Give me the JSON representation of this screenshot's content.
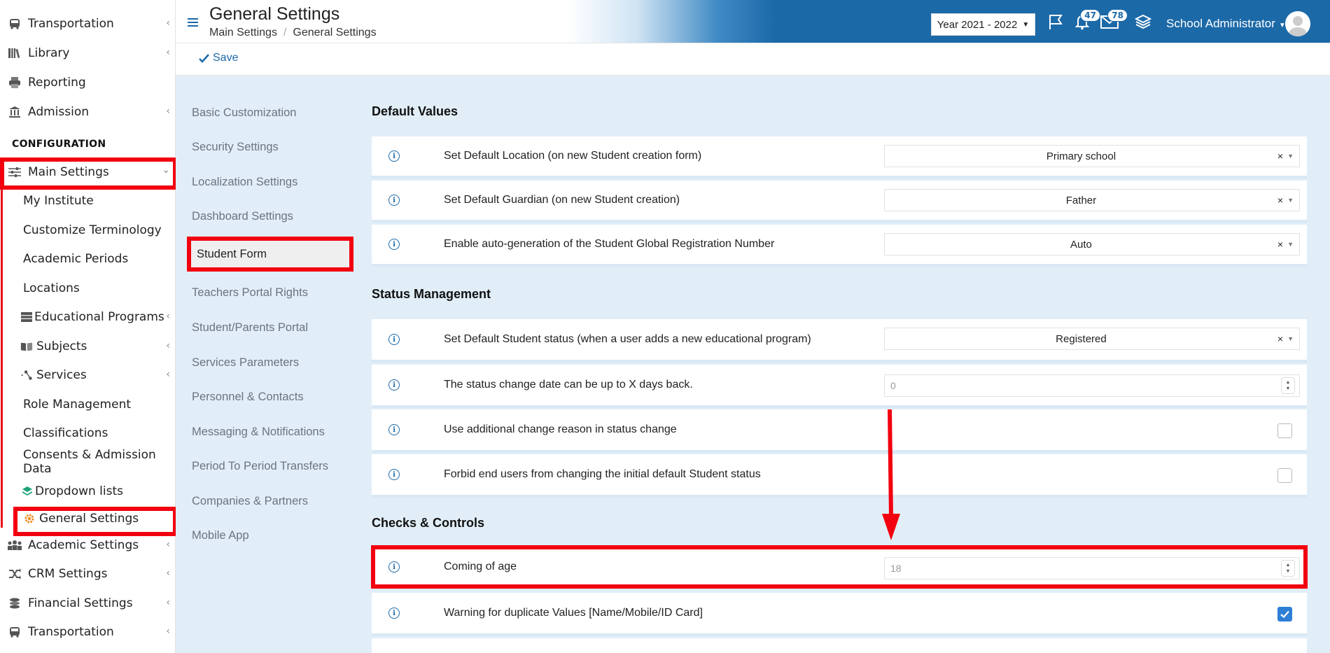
{
  "sidebar": {
    "top_items": [
      {
        "label": "Transportation",
        "icon": "bus-icon",
        "has_chevron": true
      },
      {
        "label": "Library",
        "icon": "books-icon",
        "has_chevron": true
      },
      {
        "label": "Reporting",
        "icon": "printer-icon",
        "has_chevron": false
      },
      {
        "label": "Admission",
        "icon": "bank-icon",
        "has_chevron": true
      }
    ],
    "section_header": "CONFIGURATION",
    "main_settings": {
      "label": "Main Settings",
      "icon": "sliders-icon"
    },
    "sub_items": [
      {
        "label": "My Institute"
      },
      {
        "label": "Customize Terminology"
      },
      {
        "label": "Academic Periods"
      },
      {
        "label": "Locations"
      },
      {
        "label": "Educational Programs",
        "icon": "server-icon",
        "has_chevron": true
      },
      {
        "label": "Subjects",
        "icon": "book-icon",
        "has_chevron": true
      },
      {
        "label": "Services",
        "icon": "nodes-icon",
        "has_chevron": true
      },
      {
        "label": "Role Management"
      },
      {
        "label": "Classifications"
      },
      {
        "label": "Consents & Admission Data"
      },
      {
        "label": "Dropdown lists",
        "icon": "layers-icon"
      },
      {
        "label": "General Settings",
        "icon": "gear-icon"
      }
    ],
    "bottom_items": [
      {
        "label": "Academic Settings",
        "icon": "users-icon",
        "has_chevron": true
      },
      {
        "label": "CRM Settings",
        "icon": "shuffle-icon",
        "has_chevron": true
      },
      {
        "label": "Financial Settings",
        "icon": "coins-icon",
        "has_chevron": true
      },
      {
        "label": "Transportation",
        "icon": "bus-icon",
        "has_chevron": true
      }
    ]
  },
  "header": {
    "title": "General Settings",
    "breadcrumb": [
      "Main Settings",
      "General Settings"
    ],
    "year": "Year 2021 - 2022",
    "notifications": "47",
    "messages": "78",
    "user": "School Administrator"
  },
  "toolbar": {
    "save_label": "Save"
  },
  "settings_nav": [
    "Basic Customization",
    "Security Settings",
    "Localization Settings",
    "Dashboard Settings",
    "Student Form",
    "Teachers Portal Rights",
    "Student/Parents Portal",
    "Services Parameters",
    "Personnel & Contacts",
    "Messaging & Notifications",
    "Period To Period Transfers",
    "Companies & Partners",
    "Mobile App"
  ],
  "active_nav": "Student Form",
  "sections": {
    "default_values": {
      "title": "Default Values",
      "rows": [
        {
          "label": "Set Default Location (on new Student creation form)",
          "type": "select",
          "value": "Primary school"
        },
        {
          "label": "Set Default Guardian (on new Student creation)",
          "type": "select",
          "value": "Father"
        },
        {
          "label": "Enable auto-generation of the Student Global Registration Number",
          "type": "select",
          "value": "Auto"
        }
      ]
    },
    "status_management": {
      "title": "Status Management",
      "rows": [
        {
          "label": "Set Default Student status (when a user adds a new educational program)",
          "type": "select",
          "value": "Registered"
        },
        {
          "label": "The status change date can be up to X days back.",
          "type": "number",
          "value": "0"
        },
        {
          "label": "Use additional change reason in status change",
          "type": "checkbox",
          "checked": false
        },
        {
          "label": "Forbid end users from changing the initial default Student status",
          "type": "checkbox",
          "checked": false
        }
      ]
    },
    "checks_controls": {
      "title": "Checks & Controls",
      "rows": [
        {
          "label": "Coming of age",
          "type": "number",
          "value": "18"
        },
        {
          "label": "Warning for duplicate Values [Name/Mobile/ID Card]",
          "type": "checkbox",
          "checked": true
        }
      ]
    }
  },
  "colors": {
    "brand_blue": "#1c69a8",
    "highlight_red": "#f2000f",
    "content_bg": "#e1eef8"
  }
}
